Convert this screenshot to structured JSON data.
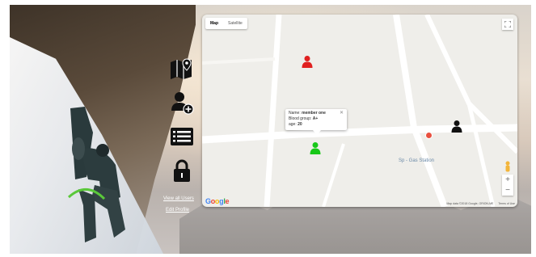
{
  "sidebar": {
    "items": [
      {
        "icon": "map-icon"
      },
      {
        "icon": "add-user-icon"
      },
      {
        "icon": "list-icon"
      },
      {
        "icon": "lock-icon"
      }
    ],
    "links": [
      "View all Users",
      "Edit Profile"
    ]
  },
  "map": {
    "map_type_options": [
      "Map",
      "Satellite"
    ],
    "selected_map_type": "Map",
    "markers": [
      {
        "color": "#e02020",
        "icon": "person-marker-icon"
      },
      {
        "color": "#18c818",
        "icon": "person-marker-icon"
      },
      {
        "color": "#111111",
        "icon": "person-marker-icon"
      }
    ],
    "infowindow": {
      "name_label": "Name:",
      "name_value": "member one",
      "blood_label": "Blood group:",
      "blood_value": "A+",
      "age_label": "age:",
      "age_value": "20"
    },
    "poi_label": "Sp - Gas Station",
    "zoom_in": "+",
    "zoom_out": "−",
    "google_logo": "Google",
    "attribution": [
      "Map data ©2018 Google, ORION-ME",
      "Terms of Use"
    ]
  },
  "colors": {
    "accent_red": "#e02020",
    "accent_green": "#18c818",
    "map_bg": "#efeeea"
  }
}
